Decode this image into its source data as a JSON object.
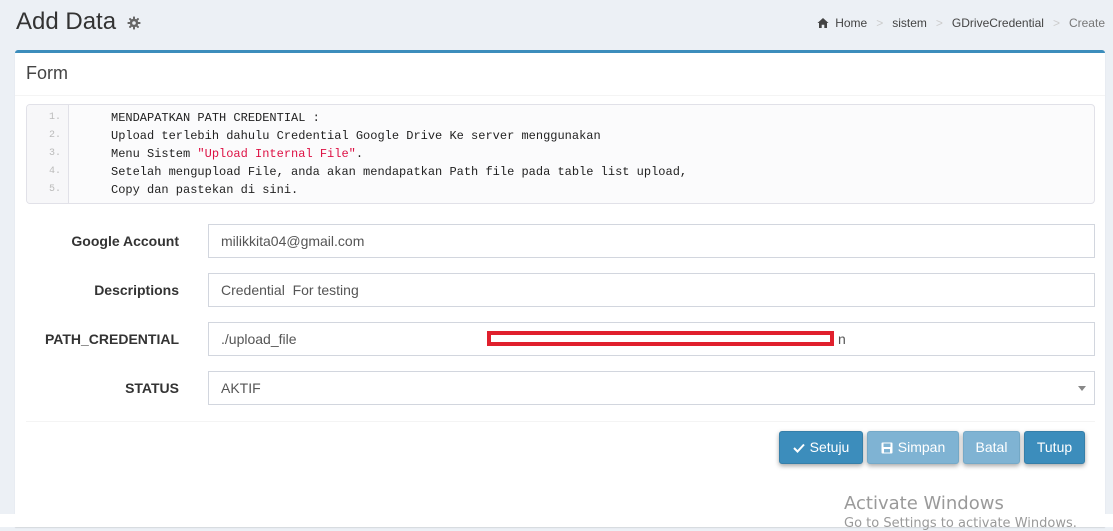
{
  "header": {
    "title": "Add Data",
    "breadcrumb": [
      "Home",
      "sistem",
      "GDriveCredential",
      "Create"
    ],
    "separator": ">"
  },
  "box": {
    "title": "Form"
  },
  "code": {
    "lines": [
      {
        "num": "1.",
        "text": "MENDAPATKAN PATH CREDENTIAL :"
      },
      {
        "num": "2.",
        "text": "Upload terlebih dahulu Credential Google Drive Ke server menggunakan"
      },
      {
        "num": "3.",
        "text": "Menu Sistem ",
        "string": "\"Upload Internal File\"",
        "after": "."
      },
      {
        "num": "4.",
        "text": "Setelah mengupload File, anda akan mendapatkan Path file pada table list upload,"
      },
      {
        "num": "5.",
        "text": "Copy dan pastekan di sini."
      }
    ]
  },
  "form": {
    "google_account": {
      "label": "Google Account",
      "value": "milikkita04@gmail.com"
    },
    "descriptions": {
      "label": "Descriptions",
      "value": "Credential  For testing"
    },
    "path_credential": {
      "label": "PATH_CREDENTIAL",
      "value_visible_start": "./upload_file",
      "value_visible_end": "n"
    },
    "status": {
      "label": "STATUS",
      "value": "AKTIF"
    }
  },
  "buttons": {
    "setuju": "Setuju",
    "simpan": "Simpan",
    "batal": "Batal",
    "tutup": "Tutup"
  },
  "watermark": {
    "line1": "Activate Windows",
    "line2": "Go to Settings to activate Windows."
  },
  "colors": {
    "accent": "#3c8dbc",
    "redaction": "#e0202d",
    "string": "#dd1144"
  },
  "icons": [
    "gear-icon",
    "home-icon",
    "check-icon",
    "save-icon",
    "caret-down-icon"
  ]
}
